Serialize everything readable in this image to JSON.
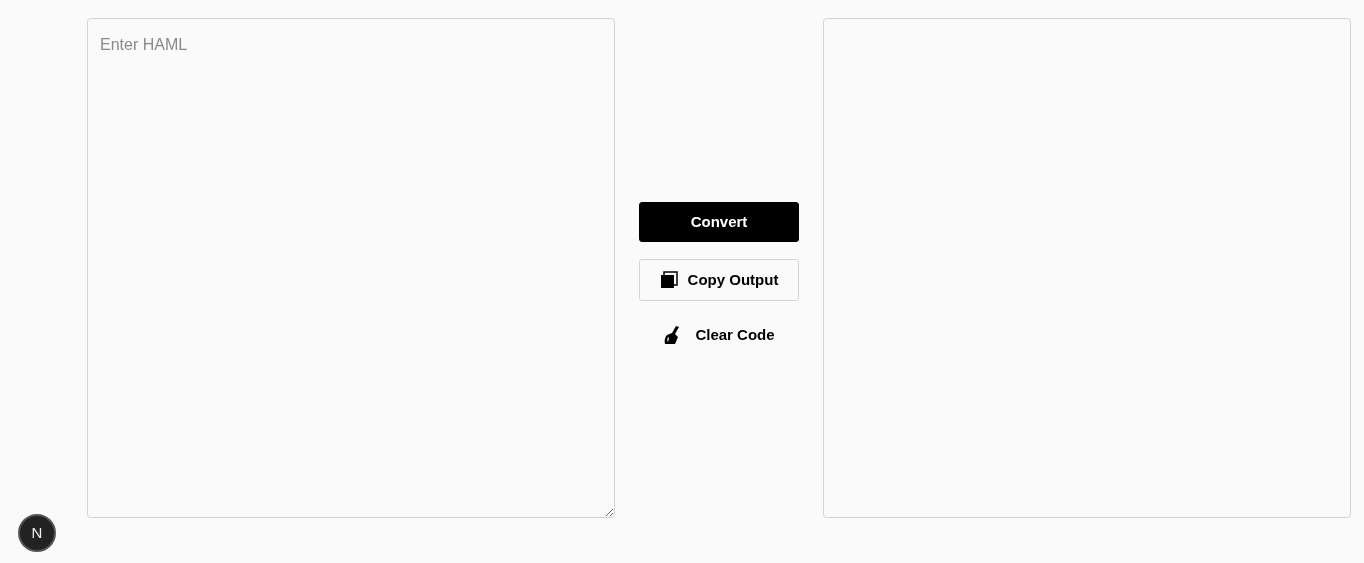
{
  "input": {
    "placeholder": "Enter HAML"
  },
  "actions": [
    {
      "kind": "primary",
      "label": "Convert"
    },
    {
      "kind": "outline",
      "label": "Copy Output"
    },
    {
      "kind": "plain",
      "label": "Clear Code"
    }
  ],
  "dev_badge": {
    "label": "N"
  }
}
